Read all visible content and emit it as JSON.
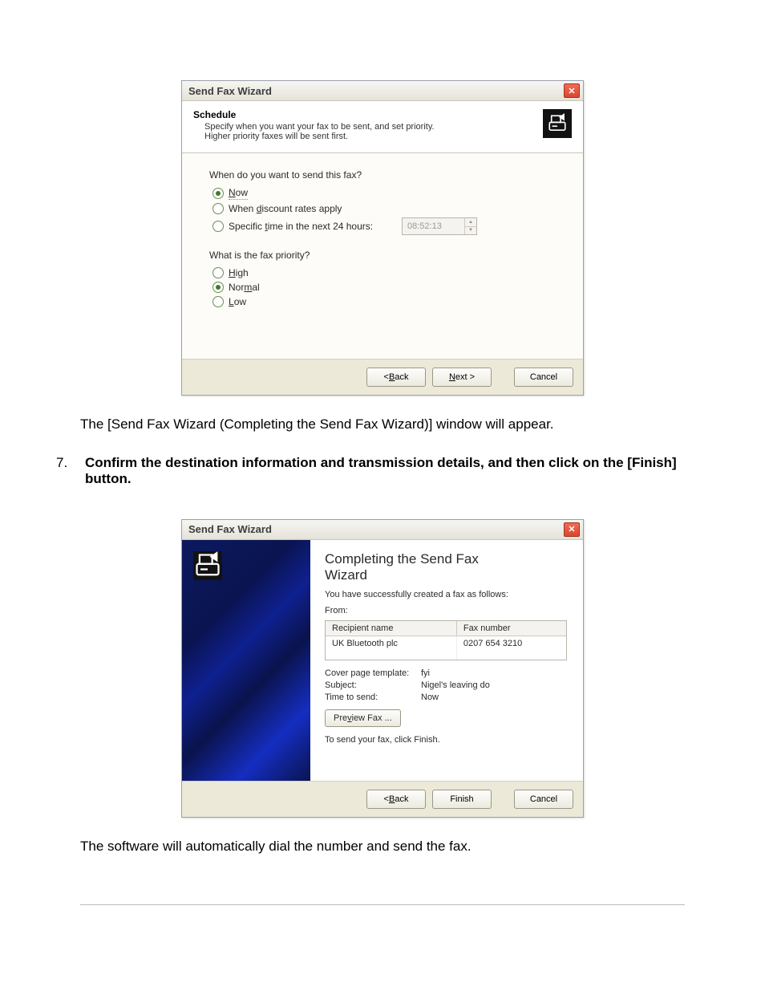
{
  "dialog1": {
    "title": "Send Fax Wizard",
    "header_title": "Schedule",
    "header_sub_line1": "Specify when you want your fax to be sent, and set priority.",
    "header_sub_line2": "Higher priority faxes will be sent first.",
    "q_when": "When do you want to send this fax?",
    "opt_now_accel": "N",
    "opt_now_rest": "ow",
    "opt_discount_pre": "When ",
    "opt_discount_accel": "d",
    "opt_discount_rest": "iscount rates apply",
    "opt_time_pre": "Specific ",
    "opt_time_accel": "t",
    "opt_time_rest": "ime in the next 24 hours:",
    "time_value": "08:52:13",
    "q_priority": "What is the fax priority?",
    "opt_high_accel": "H",
    "opt_high_rest": "igh",
    "opt_normal_pre": "Nor",
    "opt_normal_accel": "m",
    "opt_normal_rest": "al",
    "opt_low_accel": "L",
    "opt_low_rest": "ow",
    "btn_back_pre": "< ",
    "btn_back_accel": "B",
    "btn_back_rest": "ack",
    "btn_next_accel": "N",
    "btn_next_rest": "ext >",
    "btn_cancel": "Cancel"
  },
  "para1": "The [Send Fax Wizard (Completing the Send Fax Wizard)] window will appear.",
  "step7_num": "7.",
  "step7_text": "Confirm the destination information and transmission details, and then click on the [Finish] button.",
  "dialog2": {
    "title": "Send Fax Wizard",
    "comp_title_line1": "Completing the Send Fax",
    "comp_title_line2": "Wizard",
    "success": "You have successfully created a fax as follows:",
    "from": "From:",
    "col_recipient": "Recipient name",
    "col_fax": "Fax number",
    "recipient": "UK Bluetooth plc",
    "faxnum": "0207 654 3210",
    "cover_label": "Cover page template:",
    "cover_value": "fyi",
    "subject_label": "Subject:",
    "subject_value": "Nigel's leaving do",
    "time_label": "Time to send:",
    "time_value": "Now",
    "preview_pre": "Pre",
    "preview_accel": "v",
    "preview_rest": "iew Fax ...",
    "instr": "To send your fax, click Finish.",
    "btn_back_pre": "< ",
    "btn_back_accel": "B",
    "btn_back_rest": "ack",
    "btn_finish": "Finish",
    "btn_cancel": "Cancel"
  },
  "para2": "The software will automatically dial the number and send the fax."
}
